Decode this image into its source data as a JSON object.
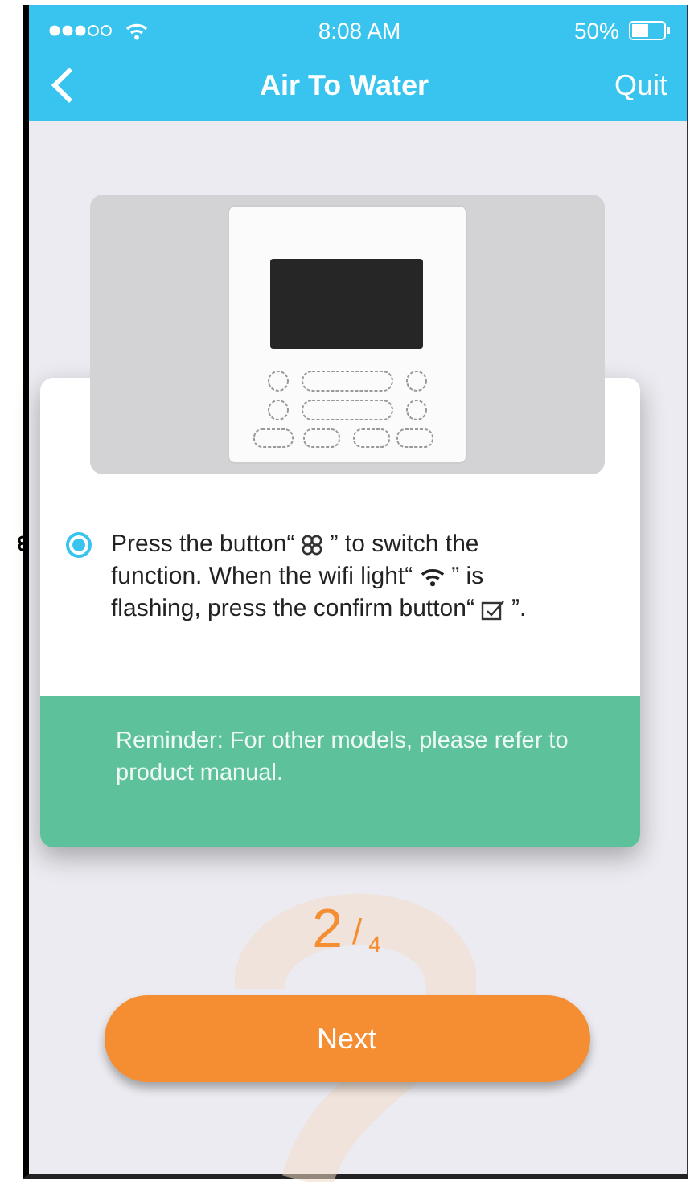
{
  "status_bar": {
    "time": "8:08 AM",
    "battery": "50%"
  },
  "nav": {
    "title": "Air To Water",
    "action": "Quit"
  },
  "step": {
    "selected": true,
    "lines": [
      {
        "before": "Press the button“",
        "after": "” to switch the"
      },
      {
        "before": "function. When the wifi light“",
        "after": "” is"
      },
      {
        "before": "flashing, press the confirm button“",
        "after": "”."
      }
    ]
  },
  "reminder": "Reminder: For other models, please refer to product manual.",
  "progress": {
    "current": "2",
    "separator": "/",
    "total": "4"
  },
  "next_button": "Next"
}
